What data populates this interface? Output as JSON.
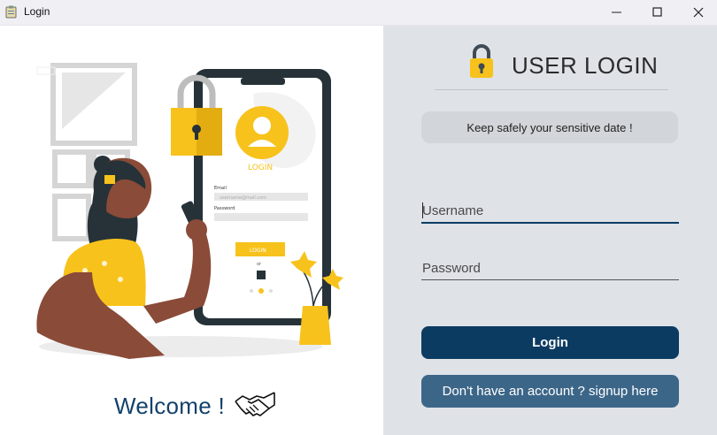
{
  "window": {
    "title": "Login"
  },
  "left": {
    "welcome": "Welcome !"
  },
  "illustration": {
    "phone_login_label": "LOGIN",
    "email_label": "Email",
    "email_placeholder": "username@mail.com",
    "password_label": "Password",
    "button_label": "LOGIN",
    "or_label": "or"
  },
  "right": {
    "heading": "USER LOGIN",
    "tagline": "Keep safely your sensitive date !",
    "username_placeholder": "Username",
    "password_placeholder": "Password",
    "login_label": "Login",
    "signup_label": "Don't have an account ? signup here"
  },
  "colors": {
    "primary": "#0c3b62",
    "secondary": "#3c6688",
    "panel": "#dfe2e6",
    "accent": "#f7c21b"
  }
}
